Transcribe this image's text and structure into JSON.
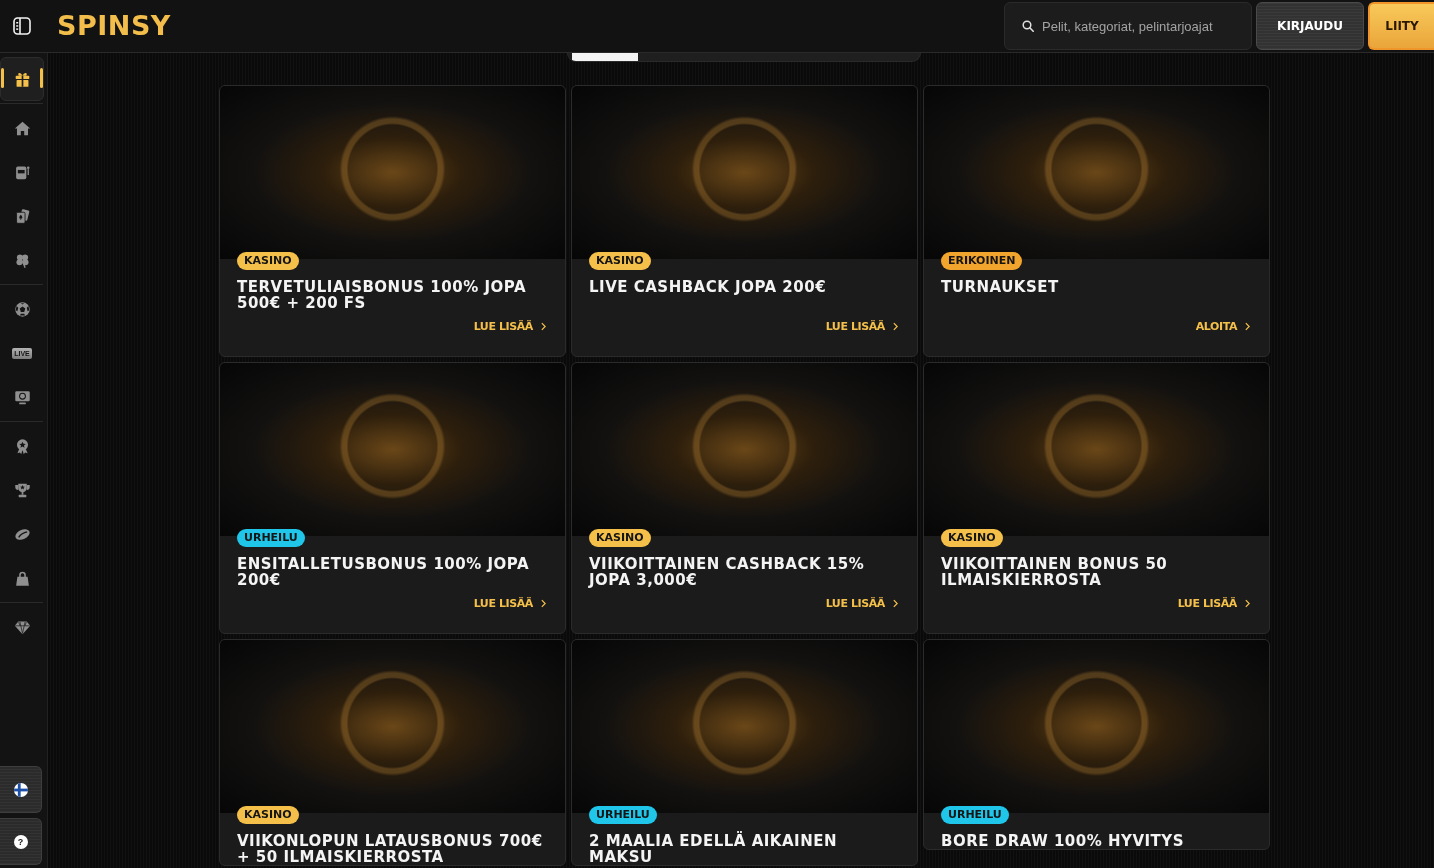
{
  "topbar": {
    "logo": "SPINSY",
    "search": {
      "placeholder": "Pelit, kategoriat, pelintarjoajat"
    },
    "buttons": [
      {
        "label": "KIRJAUDU",
        "kind": "secondary"
      },
      {
        "label": "LIITY",
        "kind": "primary"
      }
    ]
  },
  "sidebar": {
    "groups": [
      {
        "items": [
          {
            "kind": "gift",
            "selected": true
          }
        ]
      },
      {
        "items": [
          {
            "kind": "home",
            "selected": false
          },
          {
            "kind": "slots",
            "selected": false
          },
          {
            "kind": "cards",
            "selected": false
          },
          {
            "kind": "clover",
            "selected": false
          }
        ]
      },
      {
        "items": [
          {
            "kind": "soccer",
            "selected": false
          },
          {
            "kind": "live",
            "label": "LIVE",
            "selected": false
          },
          {
            "kind": "tv",
            "selected": false
          }
        ]
      },
      {
        "items": [
          {
            "kind": "rosette",
            "selected": false
          },
          {
            "kind": "trophy",
            "selected": false
          },
          {
            "kind": "rugby",
            "selected": false
          },
          {
            "kind": "bag",
            "selected": false
          }
        ]
      },
      {
        "items": [
          {
            "kind": "diamond",
            "selected": false
          }
        ]
      }
    ],
    "bottom": [
      {
        "kind": "language"
      },
      {
        "kind": "help",
        "label": "?"
      }
    ]
  },
  "cards": [
    {
      "badge": {
        "label": "KASINO",
        "color": "#f5c04a"
      },
      "title": "TERVETULIAISBONUS 100% JOPA 500€ + 200 FS",
      "link": "LUE LISÄÄ"
    },
    {
      "badge": {
        "label": "KASINO",
        "color": "#f5c04a"
      },
      "title": "LIVE CASHBACK JOPA 200€",
      "link": "LUE LISÄÄ"
    },
    {
      "badge": {
        "label": "ERIKOINEN",
        "color": "#f2a52c"
      },
      "title": "TURNAUKSET",
      "link": "ALOITA"
    },
    {
      "badge": {
        "label": "URHEILU",
        "color": "#1fc6ea"
      },
      "title": "ENSITALLETUSBONUS 100% JOPA 200€",
      "link": "LUE LISÄÄ"
    },
    {
      "badge": {
        "label": "KASINO",
        "color": "#f5c04a"
      },
      "title": "VIIKOITTAINEN CASHBACK 15% JOPA 3,000€",
      "link": "LUE LISÄÄ"
    },
    {
      "badge": {
        "label": "KASINO",
        "color": "#f5c04a"
      },
      "title": "VIIKOITTAINEN BONUS 50 ILMAISKIERROSTA",
      "link": "LUE LISÄÄ"
    },
    {
      "badge": {
        "label": "KASINO",
        "color": "#f5c04a"
      },
      "title": "VIIKONLOPUN LATAUSBONUS 700€ + 50 ILMAISKIERROSTA"
    },
    {
      "badge": {
        "label": "URHEILU",
        "color": "#1fc6ea"
      },
      "title": "2 MAALIA EDELLÄ AIKAINEN MAKSU"
    },
    {
      "badge": {
        "label": "URHEILU",
        "color": "#1fc6ea"
      },
      "title": "BORE DRAW 100% HYVITYS"
    }
  ]
}
